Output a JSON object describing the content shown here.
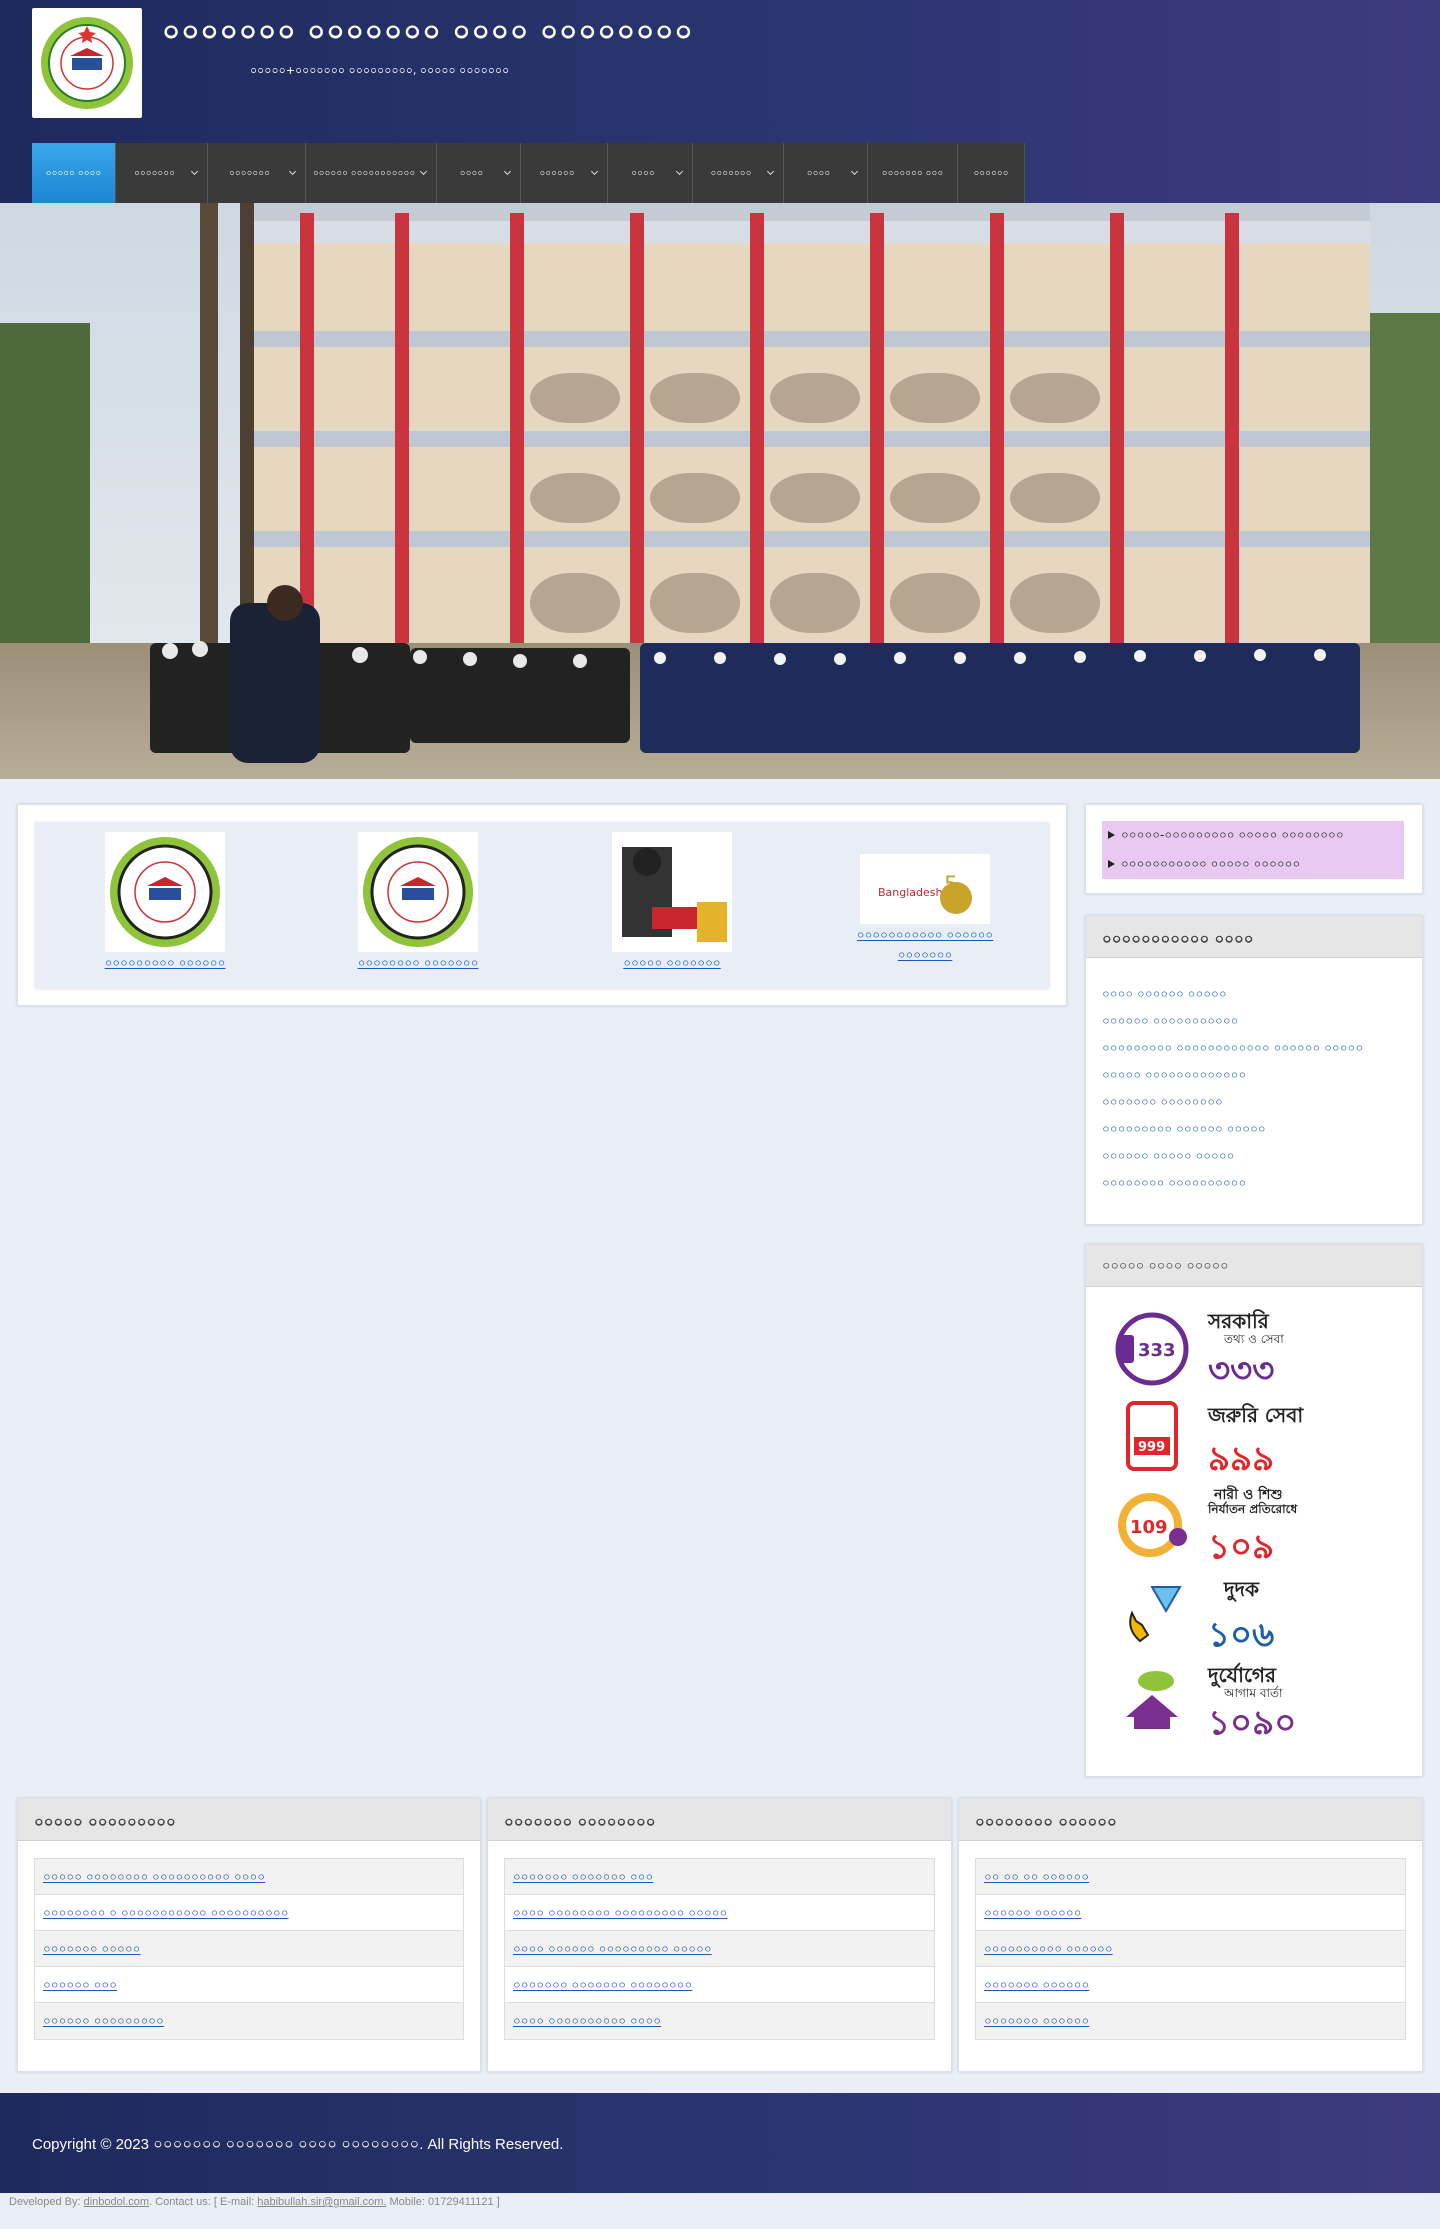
{
  "header": {
    "title": "০০০০০০০ ০০০০০০০ ০০০০ ০০০০০০০০",
    "address": "০০০০০+০০০০০০০ ০০০০০০০০০, ০০০০০ ০০০০০০০"
  },
  "nav": {
    "items": [
      {
        "label": "০০০০০ ০০০০",
        "dropdown": false,
        "active": true
      },
      {
        "label": "০০০০০০০",
        "dropdown": true
      },
      {
        "label": "০০০০০০০",
        "dropdown": true
      },
      {
        "label": "০০০০০০ ০০০০০০০০০০০",
        "dropdown": true
      },
      {
        "label": "০০০০",
        "dropdown": true
      },
      {
        "label": "০০০০০০",
        "dropdown": true
      },
      {
        "label": "০০০০",
        "dropdown": true
      },
      {
        "label": "০০০০০০০",
        "dropdown": true
      },
      {
        "label": "০০০০",
        "dropdown": true
      },
      {
        "label": "০০০০০০০ ০০০",
        "dropdown": false
      },
      {
        "label": "০০০০০০",
        "dropdown": false
      }
    ]
  },
  "tiles": [
    {
      "label": "০০০০০০০০০ ০০০০০০",
      "icon": "madrasa-logo"
    },
    {
      "label": "০০০০০০০০ ০০০০০০০",
      "icon": "madrasa-logo"
    },
    {
      "label": "০০০০০ ০০০০০০০",
      "icon": "mujib-100-logo"
    },
    {
      "label": "০০০০০০০০০০০ ০০০০০০ ০০০০০০০",
      "icon": "bangladesh-50-logo"
    }
  ],
  "notices": {
    "items": [
      "০০০০০-০০০০০০০০০ ০০০০০ ০০০০০০০০",
      "০০০০০০০০০০০ ০০০০০ ০০০০০০"
    ]
  },
  "important_links": {
    "title": "০০০০০০০০০০০ ০০০০",
    "items": [
      "০০০০ ০০০০০০ ০০০০০",
      "০০০০০০ ০০০০০০০০০০০",
      "০০০০০০০০০ ০০০০০০০০০০০০ ০০০০০০ ০০০০০",
      "০০০০০ ০০০০০০০০০০০০০",
      "০০০০০০০ ০০০০০০০০",
      "০০০০০০০০০ ০০০০০০ ০০০০০",
      "০০০০০০ ০০০০০ ০০০০০",
      "০০০০০০০০ ০০০০০০০০০০"
    ]
  },
  "hotline": {
    "title": "০০০০০ ০০০০ ০০০০০",
    "items": [
      {
        "number": "333",
        "label": "সরকারি",
        "sub": "তথ্য ও সেবা",
        "big": "৩৩৩",
        "color": "#6a2c91"
      },
      {
        "number": "999",
        "label": "জরুরি সেবা",
        "sub": "",
        "big": "৯৯৯",
        "color": "#e0252b"
      },
      {
        "number": "109",
        "label": "নারী ও শিশু",
        "sub": "নির্যাতন প্রতিরোধে",
        "big": "১০৯",
        "color": "#e0252b"
      },
      {
        "number": "",
        "label": "দুদক",
        "sub": "",
        "big": "১০৬",
        "color": "#1b5fa7"
      },
      {
        "number": "",
        "label": "দুর্যোগের",
        "sub": "আগাম বার্তা",
        "big": "১০৯০",
        "color": "#7a2f8f"
      }
    ]
  },
  "footer_boxes": [
    {
      "title": "০০০০০ ০০০০০০০০০",
      "items": [
        "০০০০০ ০০০০০০০০ ০০০০০০০০০০ ০০০০",
        "০০০০০০০০ ০ ০০০০০০০০০০০ ০০০০০০০০০০",
        "০০০০০০০ ০০০০০",
        "০০০০০০ ০০০",
        "০০০০০০ ০০০০০০০০০"
      ]
    },
    {
      "title": "০০০০০০০ ০০০০০০০০",
      "items": [
        "০০০০০০০ ০০০০০০০ ০০০",
        "০০০০ ০০০০০০০০ ০০০০০০০০০ ০০০০০",
        "০০০০ ০০০০০০ ০০০০০০০০০ ০০০০০",
        "০০০০০০০ ০০০০০০০ ০০০০০০০০",
        "০০০০ ০০০০০০০০০০ ০০০০"
      ]
    },
    {
      "title": "০০০০০০০০ ০০০০০০",
      "items": [
        "০০ ০০ ০০ ০০০০০০",
        "০০০০০০ ০০০০০০",
        "০০০০০০০০০০ ০০০০০০",
        "০০০০০০০ ০০০০০০",
        "০০০০০০০ ০০০০০০"
      ]
    }
  ],
  "copyright": "Copyright © 2023 ০০০০০০০ ০০০০০০০ ০০০০ ০০০০০০০০. All Rights Reserved.",
  "developer": {
    "prefix": "Developed By: ",
    "site": "dinbodol.com",
    "mid": ". Contact us: [ E-mail: ",
    "email": "habibullah.sir@gmail.com.",
    "suffix": " Mobile: 01729411121 ]"
  },
  "colors": {
    "header_bg": "#2b3570",
    "nav_active": "#2596e0",
    "notice_bg": "#e9c9f2",
    "link": "#2a6cc0"
  }
}
